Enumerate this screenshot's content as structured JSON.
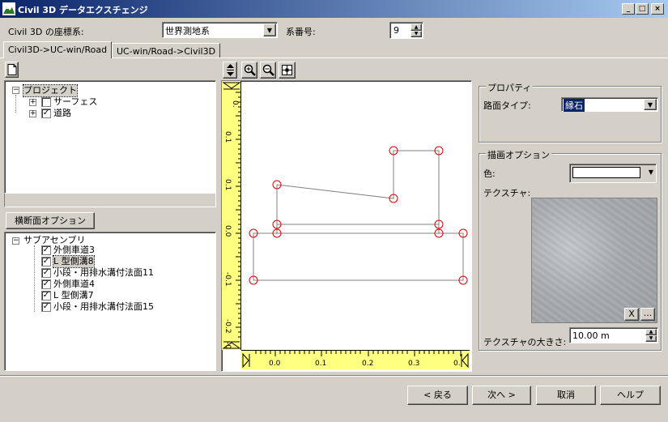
{
  "window": {
    "title": "Civil 3D データエクスチェンジ",
    "min_label": "_",
    "max_label": "□",
    "close_label": "×"
  },
  "header": {
    "coord_label": "Civil 3D の座標系:",
    "coord_value": "世界測地系",
    "zone_label": "系番号:",
    "zone_value": "9"
  },
  "tabs": [
    {
      "label": "Civil3D->UC-win/Road",
      "active": true
    },
    {
      "label": "UC-win/Road->Civil3D",
      "active": false
    }
  ],
  "project_tree": {
    "root": "プロジェクト",
    "items": [
      {
        "label": "サーフェス",
        "checked": false
      },
      {
        "label": "道路",
        "checked": true
      }
    ]
  },
  "cross_section_button": "横断面オプション",
  "assembly_tree": {
    "root": "サブアセンブリ",
    "items": [
      {
        "label": "外側車道3",
        "checked": true
      },
      {
        "label": "L 型側溝8",
        "checked": true,
        "selected": true
      },
      {
        "label": "小段・用排水溝付法面11",
        "checked": true
      },
      {
        "label": "外側車道4",
        "checked": true
      },
      {
        "label": "L 型側溝7",
        "checked": true
      },
      {
        "label": "小段・用排水溝付法面15",
        "checked": true
      }
    ]
  },
  "ruler": {
    "x_ticks": [
      "0.0",
      "0.1",
      "0.2",
      "0.3",
      "0."
    ],
    "y_ticks": [
      "0.1",
      "0.1",
      "0.0",
      "-0.1",
      "-0.2",
      "-0.3"
    ],
    "y_top": "0."
  },
  "properties": {
    "group_title": "プロパティ",
    "surface_type_label": "路面タイプ:",
    "surface_type_value": "縁石"
  },
  "drawing_options": {
    "group_title": "描画オプション",
    "color_label": "色:",
    "color_value": "#ffffff",
    "texture_label": "テクスチャ:",
    "texture_clear": "X",
    "texture_browse": "...",
    "texture_size_label": "テクスチャの大きさ:",
    "texture_size_value": "10.00 m"
  },
  "footer": {
    "back": "< 戻る",
    "next": "次へ >",
    "cancel": "取消",
    "help": "ヘルプ"
  }
}
